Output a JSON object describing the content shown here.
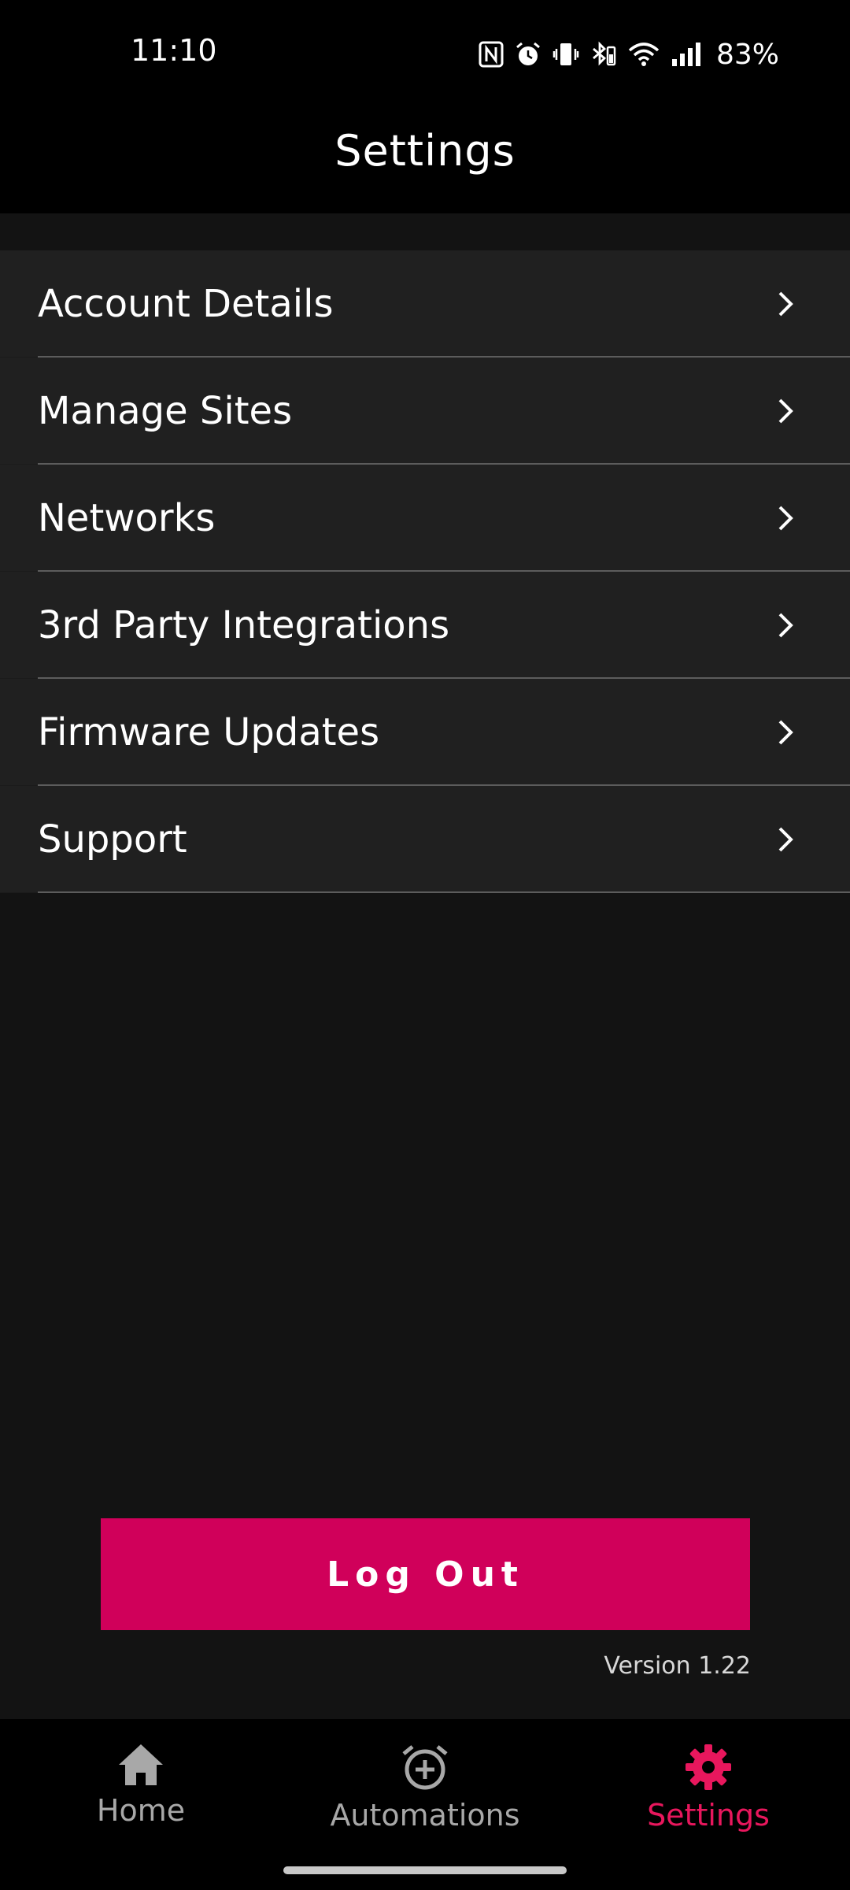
{
  "status_bar": {
    "time": "11:10",
    "battery": "83%",
    "icons": [
      "nfc-icon",
      "alarm-icon",
      "vibrate-icon",
      "bluetooth-icon",
      "wifi-icon",
      "signal-icon"
    ]
  },
  "header": {
    "title": "Settings"
  },
  "menu": {
    "items": [
      {
        "label": "Account Details"
      },
      {
        "label": "Manage Sites"
      },
      {
        "label": "Networks"
      },
      {
        "label": "3rd Party Integrations"
      },
      {
        "label": "Firmware Updates"
      },
      {
        "label": "Support"
      }
    ]
  },
  "logout": {
    "label": "Log Out"
  },
  "version": "Version 1.22",
  "bottom_nav": {
    "items": [
      {
        "label": "Home",
        "icon": "home-icon"
      },
      {
        "label": "Automations",
        "icon": "alarm-add-icon"
      },
      {
        "label": "Settings",
        "icon": "gear-icon",
        "active": true
      }
    ]
  },
  "colors": {
    "accent": "#d0005a",
    "active_nav": "#e8175d",
    "background": "#131313",
    "menu_background": "#202020"
  }
}
